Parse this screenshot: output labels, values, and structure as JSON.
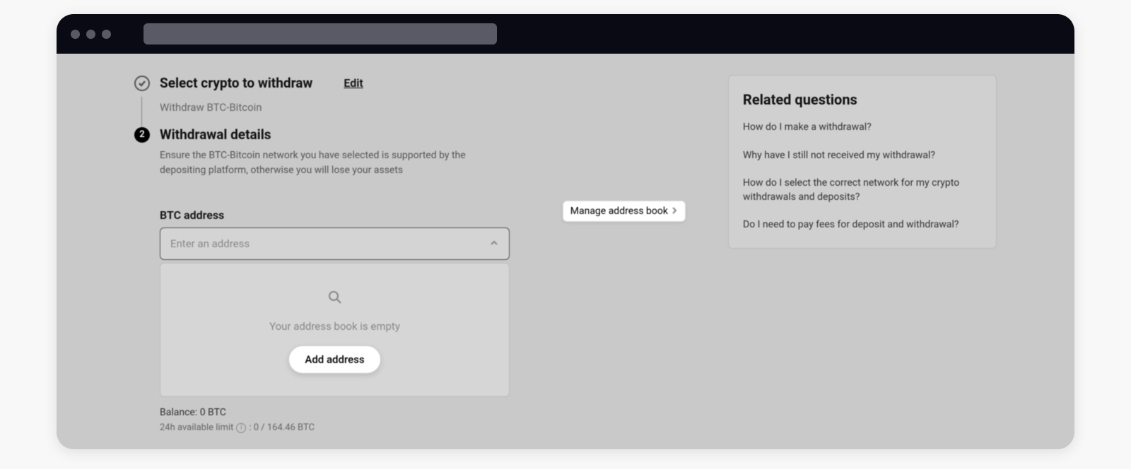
{
  "step1": {
    "title": "Select crypto to withdraw",
    "edit": "Edit",
    "subtitle": "Withdraw BTC-Bitcoin"
  },
  "step2": {
    "number": "2",
    "title": "Withdrawal details",
    "description": "Ensure the BTC-Bitcoin network you have selected is supported by the depositing platform, otherwise you will lose your assets"
  },
  "address": {
    "label": "BTC address",
    "manage": "Manage address book",
    "placeholder": "Enter an address",
    "empty": "Your address book is empty",
    "addButton": "Add address"
  },
  "balance": {
    "text": "Balance: 0 BTC",
    "limitLabel": "24h available limit",
    "limitValue": ": 0 / 164.46 BTC"
  },
  "related": {
    "title": "Related questions",
    "items": [
      "How do I make a withdrawal?",
      "Why have I still not received my withdrawal?",
      "How do I select the correct network for my crypto withdrawals and deposits?",
      "Do I need to pay fees for deposit and withdrawal?"
    ]
  }
}
